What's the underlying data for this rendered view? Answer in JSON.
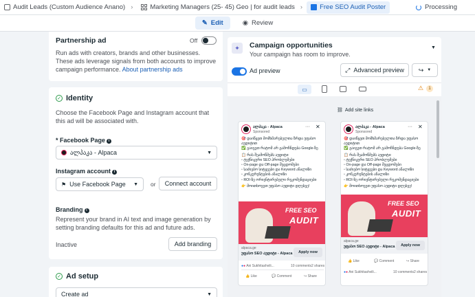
{
  "breadcrumb": {
    "campaign": "Audit Leads (Custom Audience Anano)",
    "adset": "Marketing Managers (25- 45) Geo | for audit leads",
    "ad": "Free SEO Audit Poster"
  },
  "status": "Processing",
  "tabs": {
    "edit": "Edit",
    "review": "Review"
  },
  "partnership": {
    "title": "Partnership ad",
    "toggle_label": "Off",
    "description": "Run ads with creators, brands and other businesses. These ads leverage signals from both accounts to improve campaign performance.",
    "link": "About partnership ads"
  },
  "identity": {
    "title": "Identity",
    "description": "Choose the Facebook Page and Instagram account that this ad will be associated with.",
    "fb_page_label": "* Facebook Page",
    "fb_page_value": "ალპაკა - Alpaca",
    "ig_label": "Instagram account",
    "ig_value": "Use Facebook Page",
    "or": "or",
    "connect_button": "Connect account",
    "branding_label": "Branding",
    "branding_description": "Represent your brand in AI text and image generation by setting branding defaults for this ad and future ads.",
    "branding_status": "Inactive",
    "add_branding_button": "Add branding"
  },
  "ad_setup": {
    "title": "Ad setup",
    "select_value": "Create ad"
  },
  "opportunities": {
    "title": "Campaign opportunities",
    "subtitle": "Your campaign has room to improve."
  },
  "preview": {
    "toggle_label": "Ad preview",
    "advanced_button": "Advanced preview",
    "warning_count": "1",
    "add_site_links": "Add site links",
    "page_name": "ალპაკა - Alpaca",
    "sponsored": "Sponsored",
    "ad_lines": [
      "🎯 დაიწყეთ მომხმარებელთა ზრდა უფასო აუდიტით",
      "✅ გაიგეთ რატომ არ გამოჩნდება Google-ზე",
      "📋 რას შეამოწმებს აუდიტი:",
      "▫ ტექნიკური SEO პრობლემები",
      "▫ On-page და Off-page შეცდომები",
      "▫ საძიებო სიტყვები და Keyword ანალიზი",
      "▫ კონკურენტების ანალიზი",
      "▫ ROI-ზე ორიენტირებული რეკომენდაციები",
      "👉 მოითხოვეთ უფასო აუდიტი დღესვე!"
    ],
    "creative_line1": "FREE SEO",
    "creative_line2": "AUDIT",
    "domain": "alpaca.ge",
    "headline": "უფასო SEO აუდიტი - Alpaca",
    "cta": "Apply now",
    "reactor": "Ani Sukhitashvili...",
    "comments": "10 comments",
    "shares": "2 shares",
    "like": "Like",
    "comment": "Comment",
    "share": "Share"
  }
}
